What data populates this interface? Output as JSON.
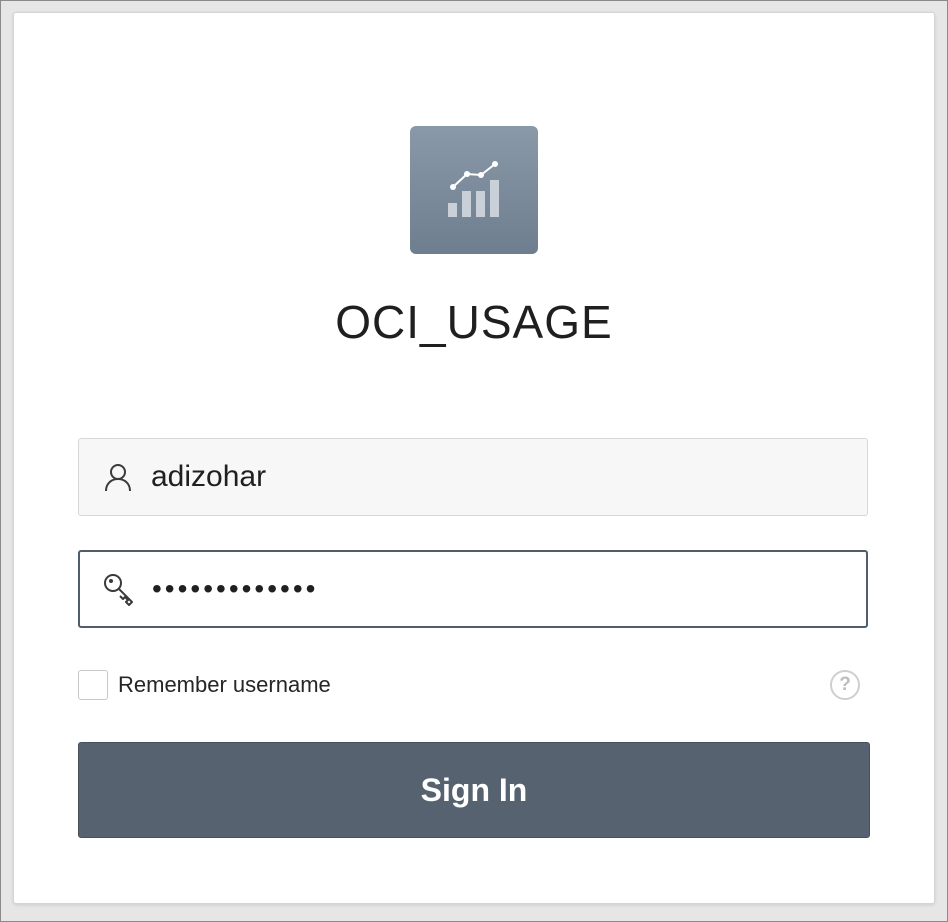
{
  "app": {
    "title": "OCI_USAGE",
    "logo_icon": "chart-bars-line-icon"
  },
  "login": {
    "username": {
      "icon": "user-icon",
      "value": "adizohar"
    },
    "password": {
      "icon": "key-icon",
      "value": "•••••••••••••"
    },
    "remember": {
      "label": "Remember username",
      "checked": false,
      "help_icon": "help-icon",
      "help_glyph": "?"
    },
    "sign_in_label": "Sign In"
  },
  "colors": {
    "button": "#56626f",
    "logo_top": "#8a99a8",
    "logo_bottom": "#6e7e8f",
    "password_border": "#505e6c"
  }
}
